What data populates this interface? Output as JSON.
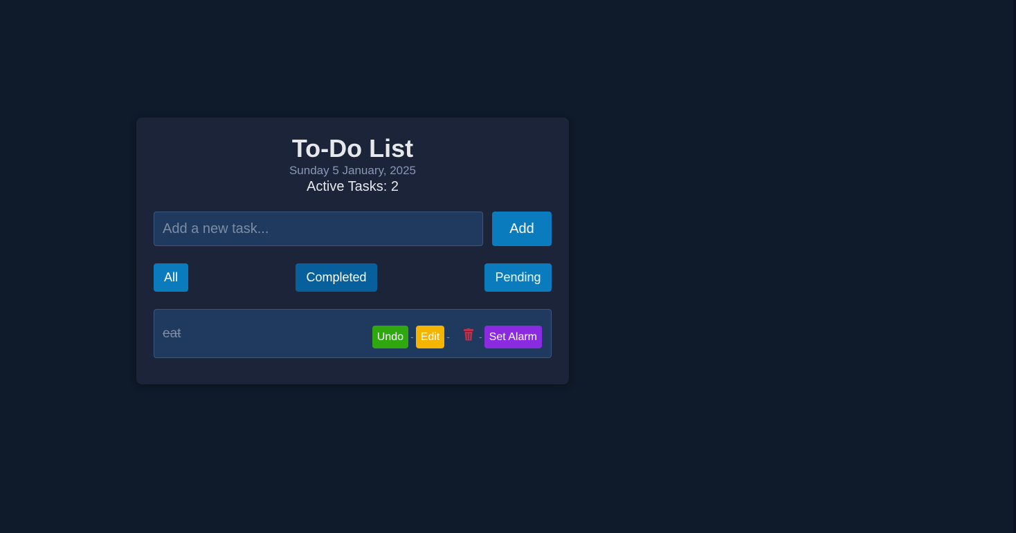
{
  "header": {
    "title": "To-Do List",
    "date": "Sunday 5 January, 2025",
    "active_tasks": "Active Tasks: 2"
  },
  "input": {
    "value": "",
    "placeholder": "Add a new task..."
  },
  "add_button": "Add",
  "filters": {
    "all": "All",
    "completed": "Completed",
    "pending": "Pending"
  },
  "tasks": [
    {
      "text": "eat",
      "completed": true,
      "actions": {
        "undo": "Undo",
        "edit": "Edit",
        "separator": "-",
        "delete_icon": "trash-icon",
        "set_alarm": "Set Alarm"
      }
    }
  ],
  "colors": {
    "background": "#0f1a2a",
    "card": "#1b2438",
    "primary": "#0a7bbd",
    "undo": "#2fa80f",
    "edit": "#f4b400",
    "alarm": "#8a2be2",
    "delete": "#c0304a"
  }
}
